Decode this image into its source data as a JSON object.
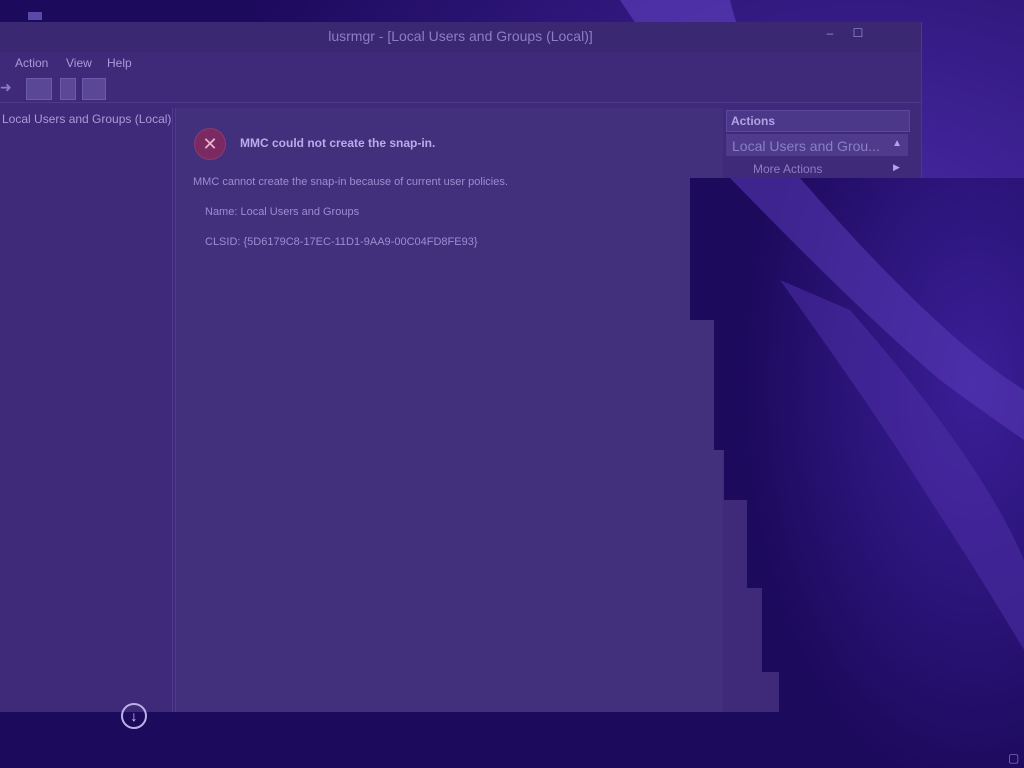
{
  "window": {
    "title": "lusrmgr - [Local Users and Groups (Local)]",
    "minimize_glyph": "–",
    "maximize_glyph": "☐"
  },
  "menu": {
    "items": [
      "Action",
      "View",
      "Help"
    ]
  },
  "tree": {
    "root_label": "Local Users and Groups (Local)"
  },
  "error": {
    "title": "MMC could not create the snap-in.",
    "message": "MMC cannot create the snap-in because of current user policies.",
    "name_line": "Name: Local Users and Groups",
    "clsid_line": "CLSID: {5D6179C8-17EC-11D1-9AA9-00C04FD8FE93}",
    "icon": "error-x-icon"
  },
  "actions": {
    "header": "Actions",
    "section_label": "Local Users and Grou...",
    "more_actions": "More Actions"
  },
  "colors": {
    "desktop_bg": "#1c0a5c",
    "window_bg": "#3e2a78",
    "content_bg": "#43307c"
  }
}
